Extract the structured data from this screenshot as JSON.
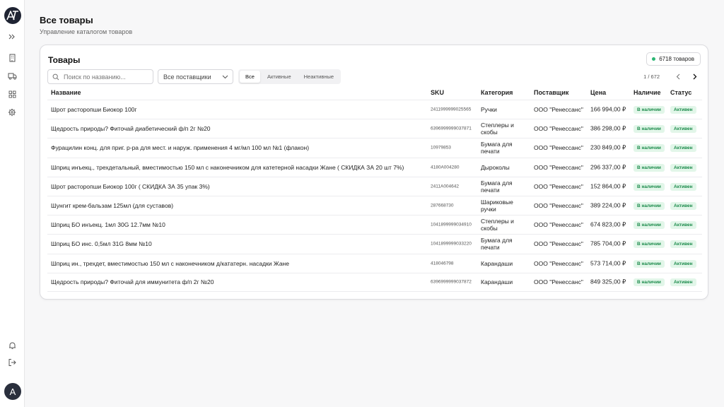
{
  "header": {
    "title": "Все товары",
    "subtitle": "Управление каталогом товаров"
  },
  "sidebar": {
    "items": [
      {
        "icon": "chevrons-right-icon"
      },
      {
        "icon": "building-icon"
      },
      {
        "icon": "truck-icon"
      },
      {
        "icon": "grid-icon"
      },
      {
        "icon": "gear-icon"
      }
    ],
    "bottom": [
      {
        "icon": "bell-icon"
      },
      {
        "icon": "logout-icon"
      }
    ],
    "avatar_initial": "A"
  },
  "card": {
    "title": "Товары",
    "count_label": "6718 товаров",
    "search_placeholder": "Поиск по названию...",
    "supplier_select": "Все поставщики",
    "filters": [
      "Все",
      "Активные",
      "Неактивные"
    ],
    "active_filter": "Все",
    "pagination": "1 / 672"
  },
  "table": {
    "columns": {
      "name": "Название",
      "sku": "SKU",
      "category": "Категория",
      "supplier": "Поставщик",
      "price": "Цена",
      "stock": "Наличие",
      "status": "Статус"
    },
    "rows": [
      {
        "name": "Шрот расторопши Биокор 100г",
        "sku": "2411999999025565",
        "category": "Ручки",
        "supplier": "ООО \"Ренессанс\"",
        "price": "166 994,00 ₽",
        "stock": "В наличии",
        "status": "Активен"
      },
      {
        "name": "Щедрость природы? Фиточай диабетический ф/п 2г №20",
        "sku": "6396999999037871",
        "category": "Степлеры и скобы",
        "supplier": "ООО \"Ренессанс\"",
        "price": "386 298,00 ₽",
        "stock": "В наличии",
        "status": "Активен"
      },
      {
        "name": "Фурацилин конц. для приг. р-ра для мест. и наруж. применения 4 мг/мл 100 мл №1 (флакон)",
        "sku": "10979853",
        "category": "Бумага для печати",
        "supplier": "ООО \"Ренессанс\"",
        "price": "230 849,00 ₽",
        "stock": "В наличии",
        "status": "Активен"
      },
      {
        "name": "Шприц инъекц., трехдетальный, вместимостью 150 мл с наконечником для катетерной насадки Жане ( СКИДКА ЗА 20 шт 7%)",
        "sku": "4180A004280",
        "category": "Дыроколы",
        "supplier": "ООО \"Ренессанс\"",
        "price": "296 337,00 ₽",
        "stock": "В наличии",
        "status": "Активен"
      },
      {
        "name": "Шрот расторопши Биокор 100г ( СКИДКА ЗА 35 упак 3%)",
        "sku": "2411A004642",
        "category": "Бумага для печати",
        "supplier": "ООО \"Ренессанс\"",
        "price": "152 864,00 ₽",
        "stock": "В наличии",
        "status": "Активен"
      },
      {
        "name": "Шунгит крем-бальзам 125мл (для суставов)",
        "sku": "287668730",
        "category": "Шариковые ручки",
        "supplier": "ООО \"Ренессанс\"",
        "price": "389 224,00 ₽",
        "stock": "В наличии",
        "status": "Активен"
      },
      {
        "name": "Шприц БО инъекц. 1мл 30G 12.7мм №10",
        "sku": "1041899999034910",
        "category": "Степлеры и скобы",
        "supplier": "ООО \"Ренессанс\"",
        "price": "674 823,00 ₽",
        "stock": "В наличии",
        "status": "Активен"
      },
      {
        "name": "Шприц БО инс. 0,5мл 31G 8мм №10",
        "sku": "1041899999033220",
        "category": "Бумага для печати",
        "supplier": "ООО \"Ренессанс\"",
        "price": "785 704,00 ₽",
        "stock": "В наличии",
        "status": "Активен"
      },
      {
        "name": "Шприц ин., трехдет, вместимостью 150 мл с наконечником д/кататерн. насадки Жане",
        "sku": "418046798",
        "category": "Карандаши",
        "supplier": "ООО \"Ренессанс\"",
        "price": "573 714,00 ₽",
        "stock": "В наличии",
        "status": "Активен"
      },
      {
        "name": "Щедрость природы? Фиточай для иммунитета ф/п 2г №20",
        "sku": "6396999999037872",
        "category": "Карандаши",
        "supplier": "ООО \"Ренессанс\"",
        "price": "849 325,00 ₽",
        "stock": "В наличии",
        "status": "Активен"
      }
    ]
  },
  "colors": {
    "accent_green": "#2bb673",
    "pill_bg": "#e2f6e9",
    "pill_text": "#1a8a4a",
    "logo_bg": "#1f2433"
  }
}
